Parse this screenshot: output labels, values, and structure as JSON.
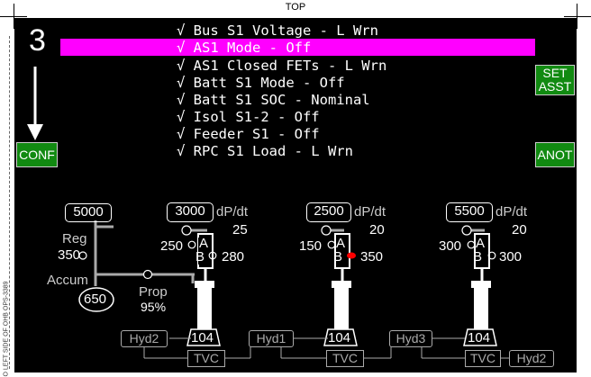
{
  "header": {
    "top_label": "TOP"
  },
  "side_label": "O LEFT SIDE OF OHB OPS-3389",
  "page_number": "3",
  "messages": [
    {
      "text": "√ Bus S1 Voltage - L Wrn",
      "highlighted": false
    },
    {
      "text": "√ AS1 Mode - Off",
      "highlighted": true
    },
    {
      "text": "√ AS1 Closed FETs - L Wrn",
      "highlighted": false
    },
    {
      "text": "√ Batt S1 Mode - Off",
      "highlighted": false
    },
    {
      "text": "√ Batt S1 SOC - Nominal",
      "highlighted": false
    },
    {
      "text": "√ Isol S1-2 - Off",
      "highlighted": false
    },
    {
      "text": "√ Feeder S1 - Off",
      "highlighted": false
    },
    {
      "text": "√ RPC S1 Load - L Wrn",
      "highlighted": false
    }
  ],
  "buttons": {
    "conf": "CONF",
    "set_asst_line1": "SET",
    "set_asst_line2": "ASST",
    "anot": "ANOT"
  },
  "colors": {
    "highlight": "#ff00ff",
    "button_green": "#118a11",
    "alert_red": "#ff0000"
  },
  "accumulator": {
    "pressure_box": "5000",
    "reg_label": "Reg",
    "reg_value": "350",
    "accum_label": "Accum",
    "accum_value": "650",
    "prop_label": "Prop",
    "prop_value": "95%"
  },
  "actuators": [
    {
      "pressure": "3000",
      "dpdt_label": "dP/dt",
      "dpdt_value": "25",
      "a_value": "250",
      "b_value": "280",
      "b_alert": false,
      "output": "104"
    },
    {
      "pressure": "2500",
      "dpdt_label": "dP/dt",
      "dpdt_value": "20",
      "a_value": "150",
      "b_value": "350",
      "b_alert": true,
      "output": "104"
    },
    {
      "pressure": "5500",
      "dpdt_label": "dP/dt",
      "dpdt_value": "20",
      "a_value": "300",
      "b_value": "300",
      "b_alert": false,
      "output": "104"
    }
  ],
  "piston_labels": {
    "a": "A",
    "b": "B"
  },
  "hydraulics": {
    "hyd2_left": "Hyd2",
    "hyd1": "Hyd1",
    "hyd3": "Hyd3",
    "hyd2_right": "Hyd2",
    "tvc": "TVC"
  }
}
